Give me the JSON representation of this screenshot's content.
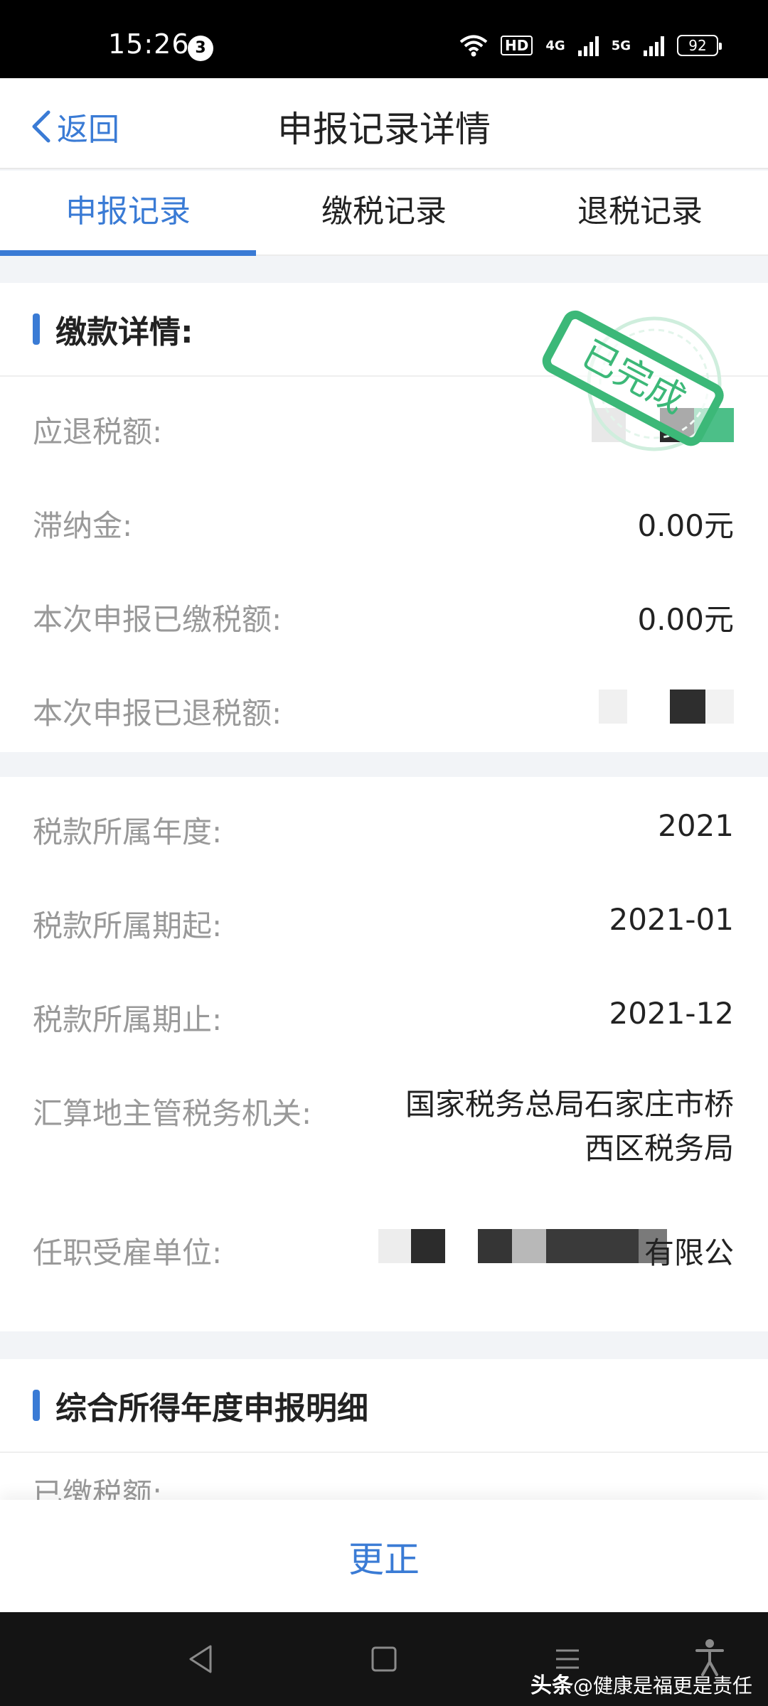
{
  "status_bar": {
    "time": "15:26",
    "notification_count": "3",
    "hd_label": "HD",
    "sim1_label": "4G",
    "sim2_label": "5G",
    "battery": "92"
  },
  "header": {
    "back_label": "返回",
    "title": "申报记录详情"
  },
  "tabs": [
    {
      "label": "申报记录",
      "active": true
    },
    {
      "label": "缴税记录",
      "active": false
    },
    {
      "label": "退税记录",
      "active": false
    }
  ],
  "payment_section": {
    "title": "缴款详情:",
    "stamp_text": "已完成",
    "rows": [
      {
        "label": "应退税额:",
        "value": ""
      },
      {
        "label": "滞纳金:",
        "value": "0.00元"
      },
      {
        "label": "本次申报已缴税额:",
        "value": "0.00元"
      },
      {
        "label": "本次申报已退税额:",
        "value": ""
      }
    ]
  },
  "tax_info": {
    "rows": [
      {
        "label": "税款所属年度:",
        "value": "2021"
      },
      {
        "label": "税款所属期起:",
        "value": "2021-01"
      },
      {
        "label": "税款所属期止:",
        "value": "2021-12"
      },
      {
        "label": "汇算地主管税务机关:",
        "value_line1": "国家税务总局石家庄市桥",
        "value_line2": "西区税务局"
      },
      {
        "label": "任职受雇单位:",
        "value": "有限公"
      }
    ]
  },
  "annual_section": {
    "title": "综合所得年度申报明细",
    "first_row_label": "已缴税额:"
  },
  "action": {
    "correct_label": "更正"
  },
  "watermark": {
    "brand": "头条",
    "handle": "@健康是福更是责任"
  },
  "colors": {
    "accent": "#3a7bd5",
    "stamp_green": "#3cb878"
  }
}
